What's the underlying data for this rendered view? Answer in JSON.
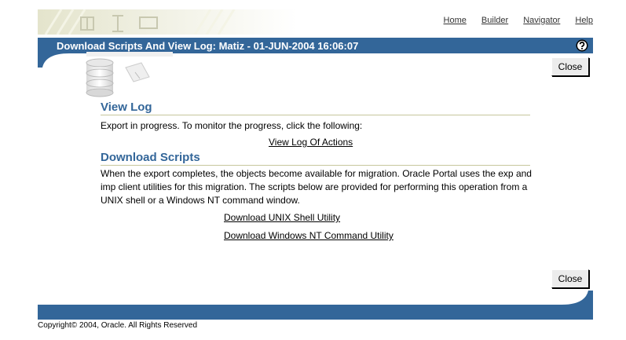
{
  "header": {
    "links": [
      "Home",
      "Builder",
      "Navigator",
      "Help"
    ],
    "title": "Download Scripts And View Log: Matiz - 01-JUN-2004 16:06:07"
  },
  "buttons": {
    "close_label": "Close"
  },
  "view_log": {
    "heading": "View Log",
    "text": "Export in progress. To monitor the progress, click the following:",
    "link": "View Log Of Actions"
  },
  "download_scripts": {
    "heading": "Download Scripts",
    "text": "When the export completes, the objects become available for migration. Oracle Portal uses the exp and imp client utilities for this migration. The scripts below are provided for performing this operation from a UNIX shell or a Windows NT command window.",
    "unix_link": "Download UNIX Shell Utility",
    "nt_link": "Download Windows NT Command Utility"
  },
  "footer": {
    "copyright": "Copyright© 2004, Oracle. All Rights Reserved"
  },
  "colors": {
    "brand": "#336699",
    "accent_line": "#c6c69c"
  },
  "icons": {
    "help": "help-icon",
    "logo": "portal-logo",
    "graphic": "database-icon"
  }
}
